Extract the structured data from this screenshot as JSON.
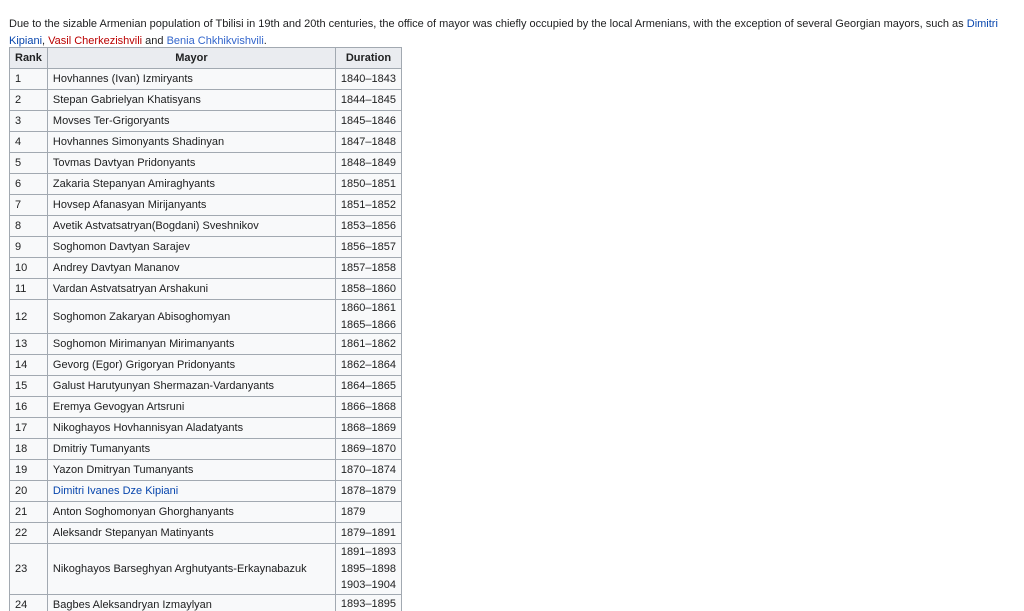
{
  "intro": {
    "text_before": "Due to the sizable Armenian population of Tbilisi in 19th and 20th centuries, the office of mayor was chiefly occupied by the local Armenians, with the exception of several Georgian mayors, such as ",
    "link1": "Dimitri Kipiani",
    "sep1": ", ",
    "link2": "Vasil Cherkezishvili",
    "sep2": " and ",
    "link3": "Benia Chkhikvishvili",
    "end": "."
  },
  "table": {
    "headers": [
      "Rank",
      "Mayor",
      "Duration"
    ],
    "rows": [
      {
        "rank": "1",
        "mayor": "Hovhannes (Ivan) Izmiryants",
        "durations": [
          "1840–1843"
        ]
      },
      {
        "rank": "2",
        "mayor": "Stepan Gabrielyan Khatisyans",
        "durations": [
          "1844–1845"
        ]
      },
      {
        "rank": "3",
        "mayor": "Movses Ter-Grigoryants",
        "durations": [
          "1845–1846"
        ]
      },
      {
        "rank": "4",
        "mayor": "Hovhannes Simonyants Shadinyan",
        "durations": [
          "1847–1848"
        ]
      },
      {
        "rank": "5",
        "mayor": "Tovmas Davtyan Pridonyants",
        "durations": [
          "1848–1849"
        ]
      },
      {
        "rank": "6",
        "mayor": "Zakaria Stepanyan Amiraghyants",
        "durations": [
          "1850–1851"
        ]
      },
      {
        "rank": "7",
        "mayor": "Hovsep Afanasyan Mirijanyants",
        "durations": [
          "1851–1852"
        ]
      },
      {
        "rank": "8",
        "mayor": "Avetik Astvatsatryan(Bogdani) Sveshnikov",
        "durations": [
          "1853–1856"
        ]
      },
      {
        "rank": "9",
        "mayor": "Soghomon Davtyan Sarajev",
        "durations": [
          "1856–1857"
        ]
      },
      {
        "rank": "10",
        "mayor": "Andrey Davtyan Mananov",
        "durations": [
          "1857–1858"
        ]
      },
      {
        "rank": "11",
        "mayor": "Vardan Astvatsatryan Arshakuni",
        "durations": [
          "1858–1860"
        ]
      },
      {
        "rank": "12",
        "mayor": "Soghomon Zakaryan Abisoghomyan",
        "durations": [
          "1860–1861",
          "1865–1866"
        ]
      },
      {
        "rank": "13",
        "mayor": "Soghomon Mirimanyan Mirimanyants",
        "durations": [
          "1861–1862"
        ]
      },
      {
        "rank": "14",
        "mayor": "Gevorg (Egor) Grigoryan Pridonyants",
        "durations": [
          "1862–1864"
        ]
      },
      {
        "rank": "15",
        "mayor": "Galust Harutyunyan Shermazan-Vardanyants",
        "durations": [
          "1864–1865"
        ]
      },
      {
        "rank": "16",
        "mayor": "Eremya Gevogyan Artsruni",
        "durations": [
          "1866–1868"
        ]
      },
      {
        "rank": "17",
        "mayor": "Nikoghayos Hovhannisyan Aladatyants",
        "durations": [
          "1868–1869"
        ]
      },
      {
        "rank": "18",
        "mayor": "Dmitriy Tumanyants",
        "durations": [
          "1869–1870"
        ]
      },
      {
        "rank": "19",
        "mayor": "Yazon Dmitryan Tumanyants",
        "durations": [
          "1870–1874"
        ]
      },
      {
        "rank": "20",
        "mayor": "Dimitri Ivanes Dze Kipiani",
        "durations": [
          "1878–1879"
        ],
        "link": true
      },
      {
        "rank": "21",
        "mayor": "Anton Soghomonyan Ghorghanyants",
        "durations": [
          "1879"
        ]
      },
      {
        "rank": "22",
        "mayor": "Aleksandr Stepanyan Matinyants",
        "durations": [
          "1879–1891"
        ]
      },
      {
        "rank": "23",
        "mayor": "Nikoghayos Barseghyan Arghutyants-Erkaynabazuk",
        "durations": [
          "1891–1893",
          "1895–1898",
          "1903–1904"
        ]
      },
      {
        "rank": "24",
        "mayor": "Bagbes Aleksandryan Izmaylyan",
        "durations": [
          "1893–1895"
        ]
      }
    ]
  }
}
